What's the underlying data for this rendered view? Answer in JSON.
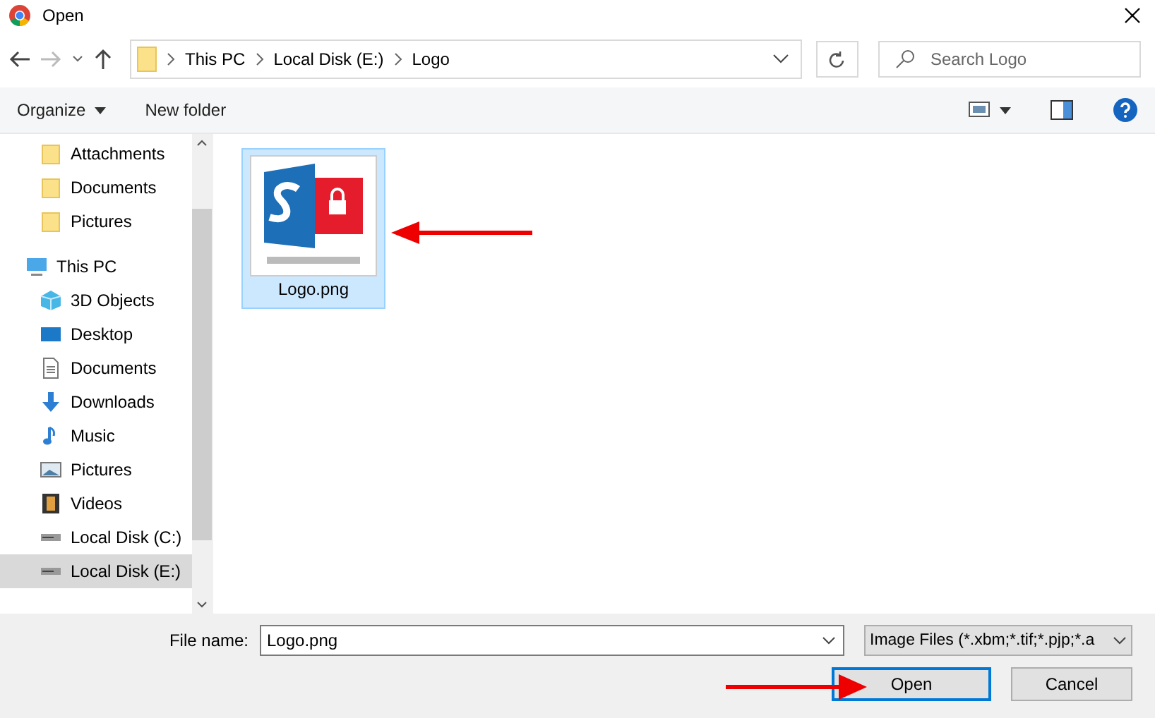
{
  "window": {
    "title": "Open"
  },
  "address_bar": {
    "path": [
      "This PC",
      "Local Disk (E:)",
      "Logo"
    ]
  },
  "search": {
    "placeholder": "Search Logo"
  },
  "toolbar": {
    "organize": "Organize",
    "new_folder": "New folder"
  },
  "sidebar": {
    "items": [
      {
        "label": "Attachments",
        "kind": "folder",
        "indented": true,
        "selected": false
      },
      {
        "label": "Documents",
        "kind": "folder",
        "indented": true,
        "selected": false
      },
      {
        "label": "Pictures",
        "kind": "folder",
        "indented": true,
        "selected": false
      },
      {
        "label": "This PC",
        "kind": "pc",
        "indented": false,
        "selected": false
      },
      {
        "label": "3D Objects",
        "kind": "cube",
        "indented": true,
        "selected": false
      },
      {
        "label": "Desktop",
        "kind": "desktop",
        "indented": true,
        "selected": false
      },
      {
        "label": "Documents",
        "kind": "document",
        "indented": true,
        "selected": false
      },
      {
        "label": "Downloads",
        "kind": "download",
        "indented": true,
        "selected": false
      },
      {
        "label": "Music",
        "kind": "music",
        "indented": true,
        "selected": false
      },
      {
        "label": "Pictures",
        "kind": "picture",
        "indented": true,
        "selected": false
      },
      {
        "label": "Videos",
        "kind": "video",
        "indented": true,
        "selected": false
      },
      {
        "label": "Local Disk (C:)",
        "kind": "drive",
        "indented": true,
        "selected": false
      },
      {
        "label": "Local Disk (E:)",
        "kind": "drive",
        "indented": true,
        "selected": true
      }
    ]
  },
  "files": [
    {
      "name": "Logo.png",
      "selected": true
    }
  ],
  "footer": {
    "file_name_label": "File name:",
    "file_name": "Logo.png",
    "file_type": "Image Files (*.xbm;*.tif;*.pjp;*.a",
    "open": "Open",
    "cancel": "Cancel"
  }
}
